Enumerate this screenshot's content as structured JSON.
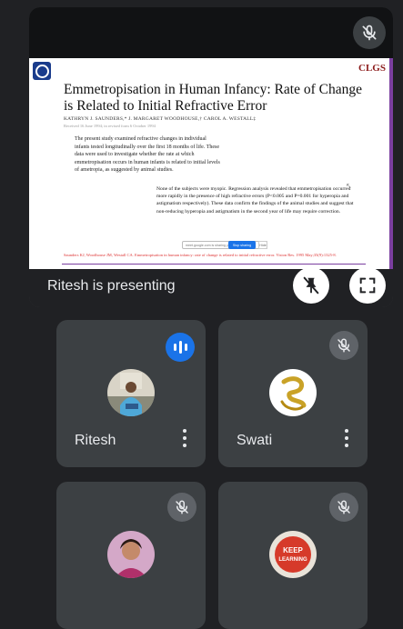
{
  "presentation": {
    "presenter_status": "Ritesh is presenting",
    "slide": {
      "logo_right_text": "CLGS",
      "title": "Emmetropisation in Human Infancy: Rate of Change is Related to Initial Refractive Error",
      "authors": "KATHRYN J. SAUNDERS,* J. MARGARET WOODHOUSE,† CAROL A. WESTALL‡",
      "meta": "Received 16 June 1994; in revised form 6 October 1994",
      "abstract": "The present study examined refractive changes in individual infants tested longitudinally over the first 18 months of life. These data were used to investigate whether the rate at which emmetropisation occurs in human infants is related to initial levels of ametropia, as suggested by animal studies.",
      "result": "None of the subjects were myopic. Regression analysis revealed that emmetropisation occurred more rapidly in the presence of high refractive errors (P<0.005 and P=0.001 for hyperopia and astigmatism respectively). These data confirm the findings of the animal studies and suggest that non-reducing hyperopia and astigmatism in the second year of life may require correction.",
      "search_placeholder": "meet.google.com is sharing your screen.",
      "search_button": "Stop sharing",
      "hide_button": "Hide",
      "citation": "Saunders KJ, Woodhouse JM, Westall CA. Emmetropisation in human infancy: rate of change is related to initial refractive error. Vision Res. 1995 May;35(9):1325-8."
    }
  },
  "participants": [
    {
      "name": "Ritesh",
      "speaking": true
    },
    {
      "name": "Swati",
      "speaking": false
    },
    {
      "name": "",
      "speaking": false
    },
    {
      "name": "",
      "speaking": false
    }
  ],
  "avatars": {
    "keep_learning_line1": "KEEP",
    "keep_learning_line2": "LEARNING"
  },
  "colors": {
    "background": "#202124",
    "tile": "#3c4043",
    "speaking_accent": "#1a73e8"
  },
  "icons": [
    "mic-off-icon",
    "pin-off-icon",
    "fullscreen-icon",
    "audio-wave-icon",
    "more-vert-icon"
  ]
}
